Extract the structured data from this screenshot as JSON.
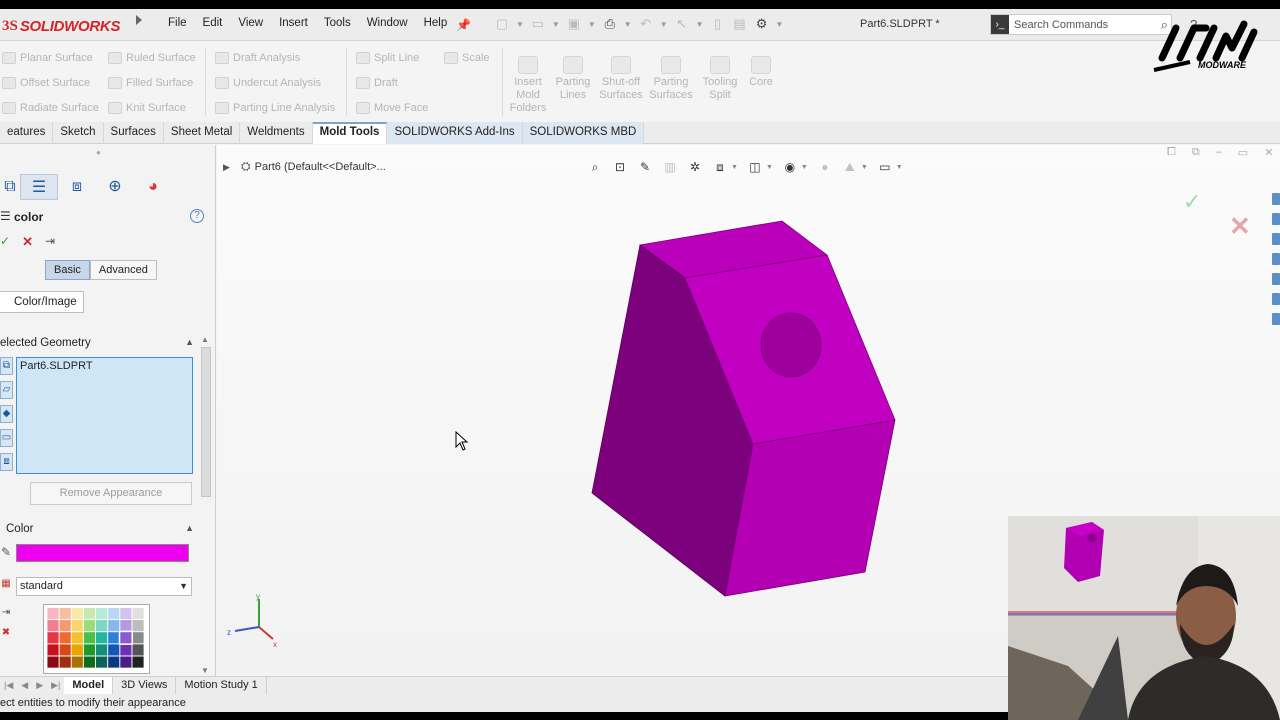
{
  "app": {
    "logo_mark": "3S",
    "logo_text": "SOLIDWORKS",
    "menu": [
      "File",
      "Edit",
      "View",
      "Insert",
      "Tools",
      "Window",
      "Help"
    ],
    "document_title": "Part6.SLDPRT *",
    "search_placeholder": "Search Commands",
    "help_label": "?"
  },
  "ribbon": {
    "col1": [
      "Planar Surface",
      "Offset Surface",
      "Radiate Surface"
    ],
    "col2": [
      "Ruled Surface",
      "Filled Surface",
      "Knit Surface"
    ],
    "col3": [
      "Draft Analysis",
      "Undercut Analysis",
      "Parting Line Analysis"
    ],
    "col4": [
      "Split Line",
      "Draft",
      "Move Face"
    ],
    "col5": [
      "Scale"
    ],
    "big": [
      {
        "line1": "Insert",
        "line2": "Mold",
        "line3": "Folders"
      },
      {
        "line1": "Parting",
        "line2": "Lines",
        "line3": ""
      },
      {
        "line1": "Shut-off",
        "line2": "Surfaces",
        "line3": ""
      },
      {
        "line1": "Parting",
        "line2": "Surfaces",
        "line3": ""
      },
      {
        "line1": "Tooling",
        "line2": "Split",
        "line3": ""
      },
      {
        "line1": "Core",
        "line2": "",
        "line3": ""
      }
    ]
  },
  "tabs": [
    "eatures",
    "Sketch",
    "Surfaces",
    "Sheet Metal",
    "Weldments",
    "Mold Tools",
    "SOLIDWORKS Add-Ins",
    "SOLIDWORKS MBD"
  ],
  "property_manager": {
    "title": "color",
    "help": "?",
    "ok_symbol": "✓",
    "cancel_symbol": "✕",
    "pin_symbol": "⇥",
    "basic_label": "Basic",
    "advanced_label": "Advanced",
    "color_image_tab": "Color/Image",
    "selected_geometry_header": "elected Geometry",
    "selected_item": "Part6.SLDPRT",
    "remove_button": "Remove Appearance",
    "color_header": "Color",
    "color_value": "#ee00ee",
    "palette_select": "standard"
  },
  "viewport": {
    "tree_label": "Part6  (Default<<Default>...",
    "part_color": "#cc00cc",
    "confirm_ok": "✓",
    "confirm_cancel": "✕"
  },
  "bottom_tabs": [
    "Model",
    "3D Views",
    "Motion Study 1"
  ],
  "status_text": "ect entities to modify their appearance",
  "watermark_text": "MODWARE"
}
